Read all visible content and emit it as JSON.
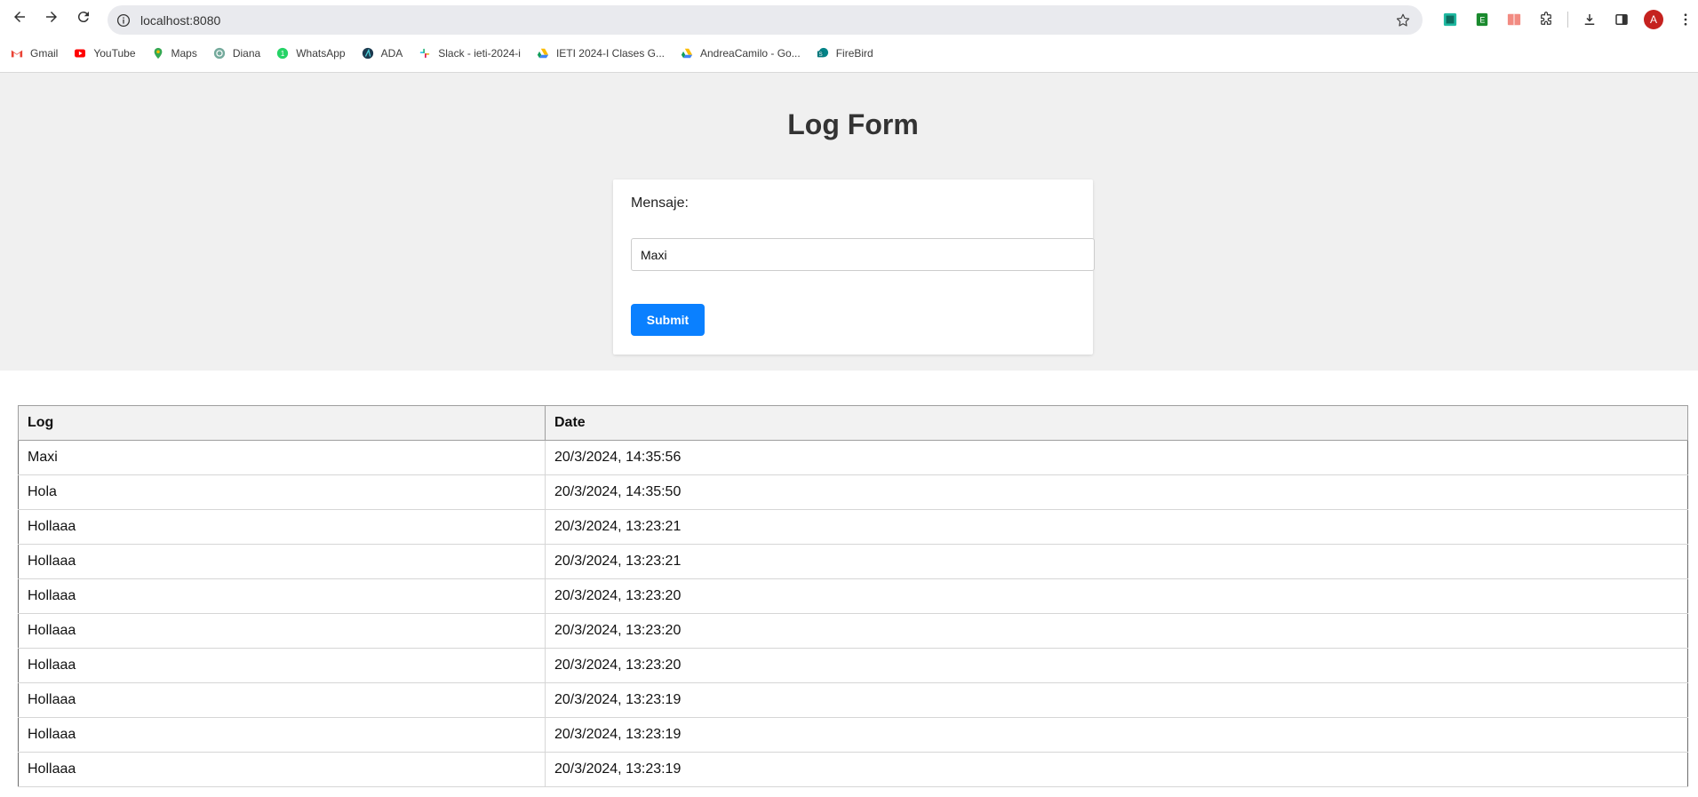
{
  "browser": {
    "url": "localhost:8080",
    "bookmarks": [
      {
        "label": "Gmail",
        "icon": "gmail-icon"
      },
      {
        "label": "YouTube",
        "icon": "youtube-icon"
      },
      {
        "label": "Maps",
        "icon": "maps-icon"
      },
      {
        "label": "Diana",
        "icon": "chatgpt-icon"
      },
      {
        "label": "WhatsApp",
        "icon": "whatsapp-icon"
      },
      {
        "label": "ADA",
        "icon": "ada-icon"
      },
      {
        "label": "Slack - ieti-2024-i",
        "icon": "slack-icon"
      },
      {
        "label": "IETI 2024-I Clases G...",
        "icon": "google-drive-icon"
      },
      {
        "label": "AndreaCamilo - Go...",
        "icon": "google-drive-icon"
      },
      {
        "label": "FireBird",
        "icon": "sharepoint-icon"
      }
    ],
    "avatar_letter": "A"
  },
  "form": {
    "title": "Log Form",
    "label": "Mensaje:",
    "value": "Maxi",
    "submit_label": "Submit"
  },
  "table": {
    "headers": [
      "Log",
      "Date"
    ],
    "rows": [
      [
        "Maxi",
        "20/3/2024, 14:35:56"
      ],
      [
        "Hola",
        "20/3/2024, 14:35:50"
      ],
      [
        "Hollaaa",
        "20/3/2024, 13:23:21"
      ],
      [
        "Hollaaa",
        "20/3/2024, 13:23:21"
      ],
      [
        "Hollaaa",
        "20/3/2024, 13:23:20"
      ],
      [
        "Hollaaa",
        "20/3/2024, 13:23:20"
      ],
      [
        "Hollaaa",
        "20/3/2024, 13:23:20"
      ],
      [
        "Hollaaa",
        "20/3/2024, 13:23:19"
      ],
      [
        "Hollaaa",
        "20/3/2024, 13:23:19"
      ],
      [
        "Hollaaa",
        "20/3/2024, 13:23:19"
      ]
    ]
  },
  "colors": {
    "accent": "#0a80ff",
    "form_background": "#f0f0f0",
    "avatar": "#c5221f"
  }
}
